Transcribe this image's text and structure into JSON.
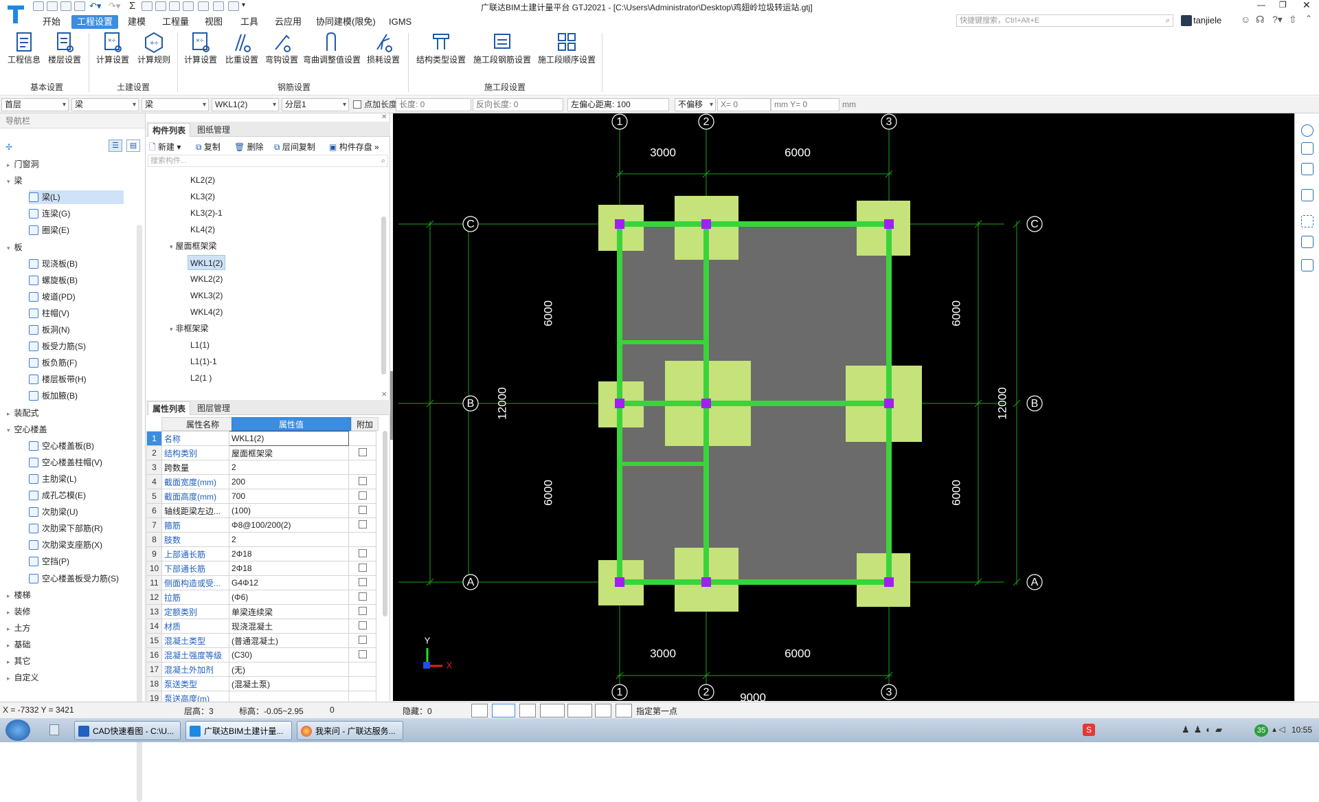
{
  "window": {
    "title": "广联达BIM土建计量平台 GTJ2021 - [C:\\Users\\Administrator\\Desktop\\鸡翅岭垃圾转运站.gtj]",
    "search_placeholder": "快捷键搜索，Ctrl+Alt+E",
    "user": "tanjiele"
  },
  "menu": [
    "开始",
    "工程设置",
    "建模",
    "工程量",
    "视图",
    "工具",
    "云应用",
    "协同建模(限免)",
    "IGMS"
  ],
  "ribbon": {
    "groups": [
      {
        "label": "基本设置",
        "buttons": [
          "工程信息",
          "楼层设置"
        ]
      },
      {
        "label": "土建设置",
        "buttons": [
          "计算设置",
          "计算规则"
        ]
      },
      {
        "label": "钢筋设置",
        "buttons": [
          "计算设置",
          "比重设置",
          "弯钩设置",
          "弯曲调整值设置",
          "损耗设置"
        ]
      },
      {
        "label": "施工段设置",
        "buttons": [
          "结构类型设置",
          "施工段钢筋设置",
          "施工段顺序设置"
        ]
      }
    ]
  },
  "propbar": {
    "floor": "首层",
    "type1": "梁",
    "type2": "梁",
    "element": "WKL1(2)",
    "layer": "分层1",
    "point_length_label": "点加长度",
    "length_label": "长度: 0",
    "reverse_length_label": "反向长度: 0",
    "offset_label": "左偏心距离: 100",
    "no_offset": "不偏移",
    "x_label": "X= 0",
    "mm_y": "mm Y= 0",
    "mm": "mm"
  },
  "nav": {
    "title": "导航栏",
    "items": [
      {
        "label": "门窗洞",
        "level": 0
      },
      {
        "label": "梁",
        "level": 0,
        "expanded": true
      },
      {
        "label": "梁(L)",
        "level": 1,
        "selected": true
      },
      {
        "label": "连梁(G)",
        "level": 1
      },
      {
        "label": "圈梁(E)",
        "level": 1
      },
      {
        "label": "板",
        "level": 0,
        "expanded": true
      },
      {
        "label": "现浇板(B)",
        "level": 1
      },
      {
        "label": "螺旋板(B)",
        "level": 1
      },
      {
        "label": "坡道(PD)",
        "level": 1
      },
      {
        "label": "柱帽(V)",
        "level": 1
      },
      {
        "label": "板洞(N)",
        "level": 1
      },
      {
        "label": "板受力筋(S)",
        "level": 1
      },
      {
        "label": "板负筋(F)",
        "level": 1
      },
      {
        "label": "楼层板带(H)",
        "level": 1
      },
      {
        "label": "板加腋(B)",
        "level": 1
      },
      {
        "label": "装配式",
        "level": 0
      },
      {
        "label": "空心楼盖",
        "level": 0,
        "expanded": true
      },
      {
        "label": "空心楼盖板(B)",
        "level": 1
      },
      {
        "label": "空心楼盖柱帽(V)",
        "level": 1
      },
      {
        "label": "主肋梁(L)",
        "level": 1
      },
      {
        "label": "成孔芯模(E)",
        "level": 1
      },
      {
        "label": "次肋梁(U)",
        "level": 1
      },
      {
        "label": "次肋梁下部筋(R)",
        "level": 1
      },
      {
        "label": "次肋梁支座筋(X)",
        "level": 1
      },
      {
        "label": "空挡(P)",
        "level": 1
      },
      {
        "label": "空心楼盖板受力筋(S)",
        "level": 1
      },
      {
        "label": "楼梯",
        "level": 0
      },
      {
        "label": "装修",
        "level": 0
      },
      {
        "label": "土方",
        "level": 0
      },
      {
        "label": "基础",
        "level": 0
      },
      {
        "label": "其它",
        "level": 0
      },
      {
        "label": "自定义",
        "level": 0
      }
    ]
  },
  "component": {
    "tabs": [
      "构件列表",
      "图纸管理"
    ],
    "toolbar": [
      "新建",
      "复制",
      "删除",
      "层间复制",
      "构件存盘"
    ],
    "search_placeholder": "搜索构件...",
    "items": [
      {
        "label": "KL2(2)",
        "level": 2
      },
      {
        "label": "KL3(2)",
        "level": 2
      },
      {
        "label": "KL3(2)-1",
        "level": 2
      },
      {
        "label": "KL4(2)",
        "level": 2
      },
      {
        "label": "屋面框架梁",
        "level": 1
      },
      {
        "label": "WKL1(2)",
        "level": 2,
        "selected": true
      },
      {
        "label": "WKL2(2)",
        "level": 2
      },
      {
        "label": "WKL3(2)",
        "level": 2
      },
      {
        "label": "WKL4(2)",
        "level": 2
      },
      {
        "label": "非框架梁",
        "level": 1
      },
      {
        "label": "L1(1)",
        "level": 2
      },
      {
        "label": "L1(1)-1",
        "level": 2
      },
      {
        "label": "L2(1 )",
        "level": 2
      }
    ]
  },
  "properties": {
    "tabs": [
      "属性列表",
      "图层管理"
    ],
    "headers": [
      "属性名称",
      "属性值",
      "附加"
    ],
    "rows": [
      {
        "n": "1",
        "k": "名称",
        "v": "WKL1(2)",
        "cb": false
      },
      {
        "n": "2",
        "k": "结构类别",
        "v": "屋面框架梁",
        "cb": true
      },
      {
        "n": "3",
        "k": "跨数量",
        "v": "2",
        "cb": false,
        "black": true
      },
      {
        "n": "4",
        "k": "截面宽度(mm)",
        "v": "200",
        "cb": true
      },
      {
        "n": "5",
        "k": "截面高度(mm)",
        "v": "700",
        "cb": true
      },
      {
        "n": "6",
        "k": "轴线距梁左边...",
        "v": "(100)",
        "cb": true,
        "black": true
      },
      {
        "n": "7",
        "k": "箍筋",
        "v": "Φ8@100/200(2)",
        "cb": true
      },
      {
        "n": "8",
        "k": "肢数",
        "v": "2",
        "cb": false
      },
      {
        "n": "9",
        "k": "上部通长筋",
        "v": "2Φ18",
        "cb": true
      },
      {
        "n": "10",
        "k": "下部通长筋",
        "v": "2Φ18",
        "cb": true
      },
      {
        "n": "11",
        "k": "侧面构造或受...",
        "v": "G4Φ12",
        "cb": true
      },
      {
        "n": "12",
        "k": "拉筋",
        "v": "(Φ6)",
        "cb": true
      },
      {
        "n": "13",
        "k": "定额类别",
        "v": "单梁连续梁",
        "cb": true
      },
      {
        "n": "14",
        "k": "材质",
        "v": "现浇混凝土",
        "cb": true
      },
      {
        "n": "15",
        "k": "混凝土类型",
        "v": "(普通混凝土)",
        "cb": true
      },
      {
        "n": "16",
        "k": "混凝土强度等级",
        "v": "(C30)",
        "cb": true
      },
      {
        "n": "17",
        "k": "混凝土外加剂",
        "v": "(无)",
        "cb": false
      },
      {
        "n": "18",
        "k": "泵送类型",
        "v": "(混凝土泵)",
        "cb": false
      },
      {
        "n": "19",
        "k": "泵送高度(m)",
        "v": "",
        "cb": false
      }
    ]
  },
  "drawing": {
    "axes_x": [
      "1",
      "2",
      "3"
    ],
    "axes_y": [
      "C",
      "B",
      "A"
    ],
    "dims_top": [
      "3000",
      "6000"
    ],
    "dims_bottom": [
      "3000",
      "6000"
    ],
    "dims_left": [
      "6000",
      "6000"
    ],
    "dims_right": [
      "6000",
      "6000"
    ],
    "total_left": "12000",
    "total_right": "12000",
    "total_bottom": "9000",
    "ucs_x": "X",
    "ucs_y": "Y",
    "colors": {
      "beam": "#39d43a",
      "column": "#a020f0",
      "footing": "#c6e27a",
      "slab": "#6b6b6b",
      "grid": "#1aa31a"
    }
  },
  "status": {
    "coords": "X = -7332 Y = 3421",
    "floor_height": "层高：3",
    "elevation": "标高：-0.05~2.95",
    "zero": "0",
    "hidden": "隐藏：0",
    "hint": "指定第一点"
  },
  "taskbar": {
    "tasks": [
      "CAD快速看图 - C:\\U...",
      "广联达BIM土建计量...",
      "我来问 - 广联达服务..."
    ],
    "badge": "35",
    "clock": "10:55"
  }
}
